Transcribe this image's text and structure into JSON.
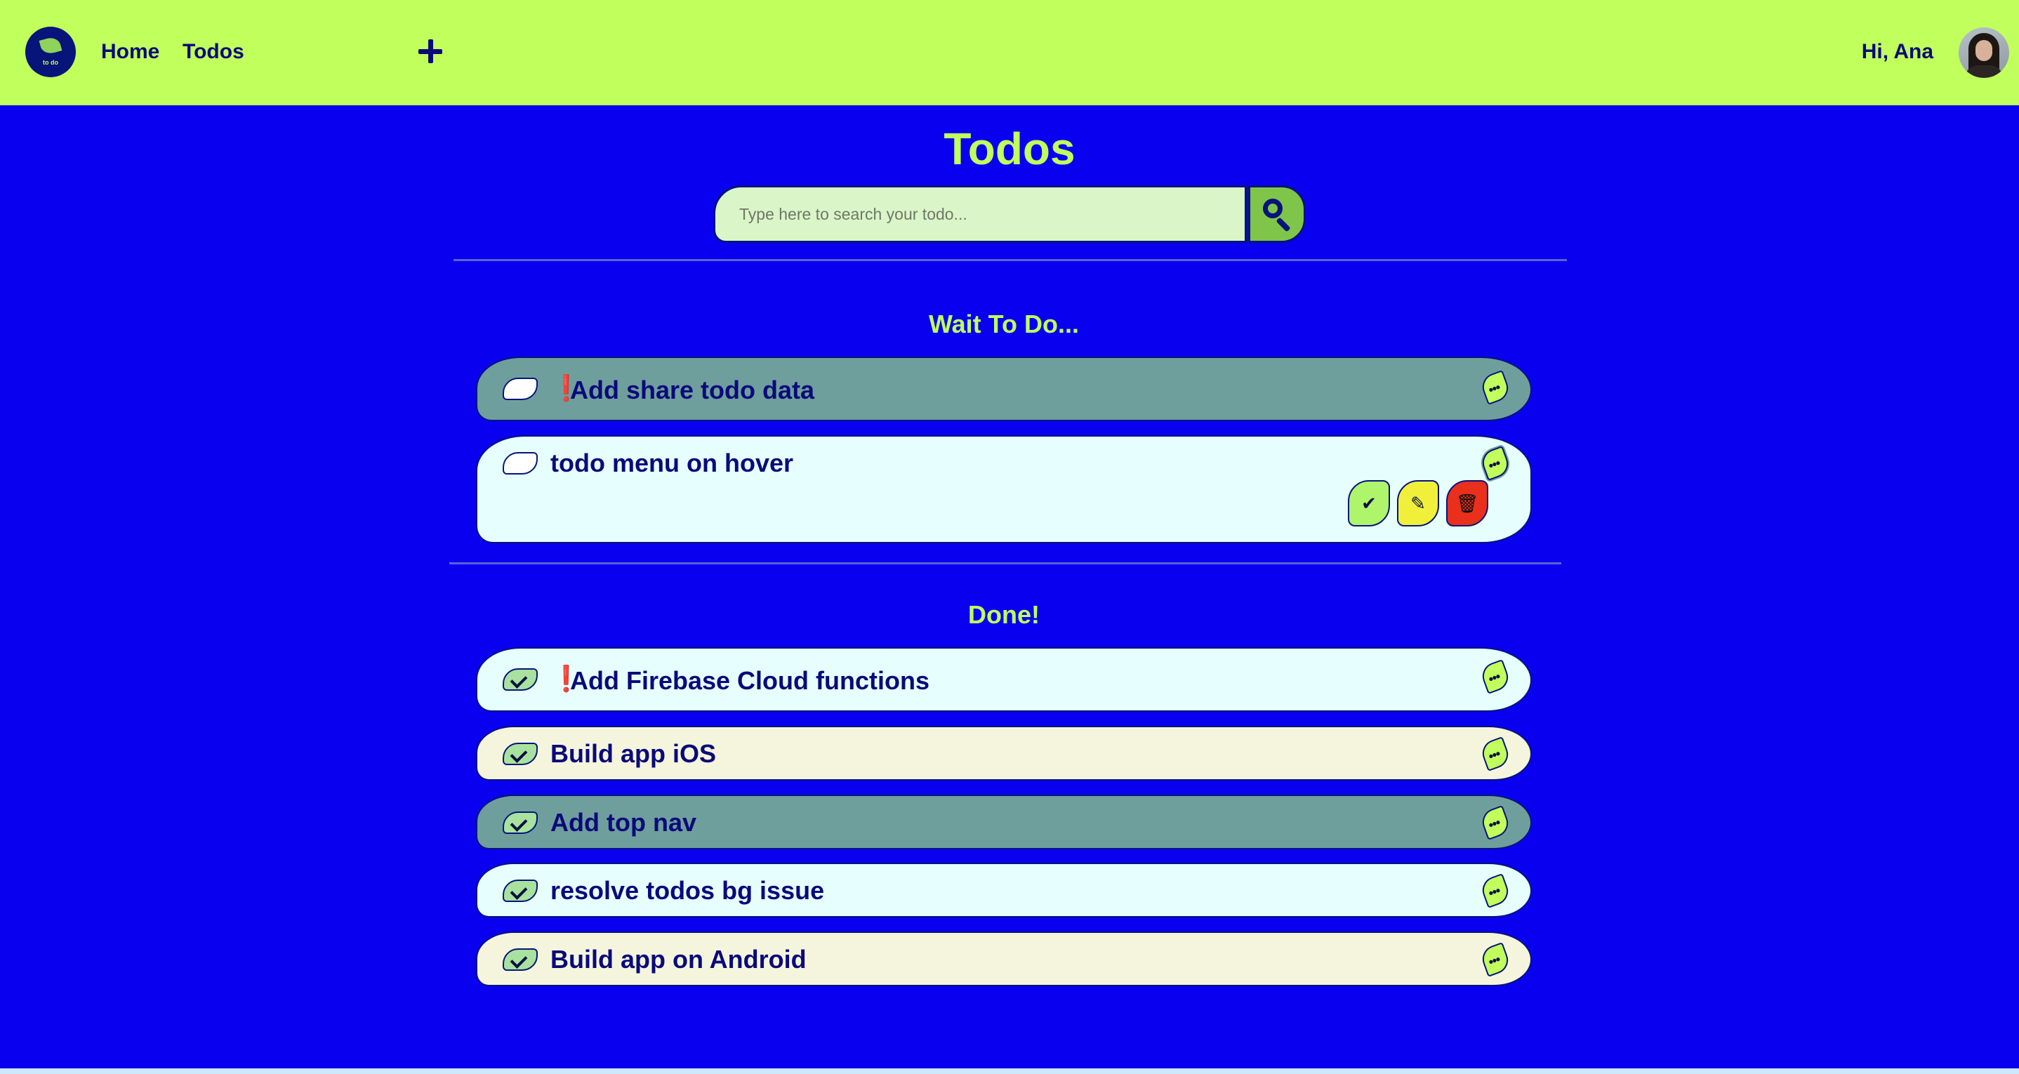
{
  "nav": {
    "logo_text": "to do",
    "links": [
      {
        "label": "Home"
      },
      {
        "label": "Todos"
      }
    ],
    "greeting": "Hi, Ana"
  },
  "page": {
    "title": "Todos",
    "search": {
      "placeholder": "Type here to search your todo...",
      "value": ""
    }
  },
  "sections": {
    "pending": {
      "title": "Wait To Do...",
      "items": [
        {
          "text": "Add share todo data",
          "important": true,
          "done": false,
          "color": "#6e9f9d"
        },
        {
          "text": "todo menu on hover",
          "important": false,
          "done": false,
          "color": "#e6fffe",
          "menu_open": true
        }
      ]
    },
    "done": {
      "title": "Done!",
      "items": [
        {
          "text": "Add Firebase Cloud functions",
          "important": true,
          "done": true,
          "color": "#e6fffe"
        },
        {
          "text": "Build app iOS",
          "important": false,
          "done": true,
          "color": "#f5f5dd"
        },
        {
          "text": "Add top nav",
          "important": false,
          "done": true,
          "color": "#6e9f9d"
        },
        {
          "text": "resolve todos bg issue",
          "important": false,
          "done": true,
          "color": "#e6fffe"
        },
        {
          "text": "Build app on Android",
          "important": false,
          "done": true,
          "color": "#f5f5dd"
        }
      ]
    }
  },
  "icons": {
    "priority": "❗",
    "more": "•••",
    "complete": "✔",
    "edit": "✎",
    "delete": "🗑"
  },
  "colors": {
    "background": "#0a00f0",
    "nav": "#c1ff5c",
    "accent": "#c1ff5c",
    "text_dark": "#0a0a7a",
    "priority": "#e2231a"
  }
}
